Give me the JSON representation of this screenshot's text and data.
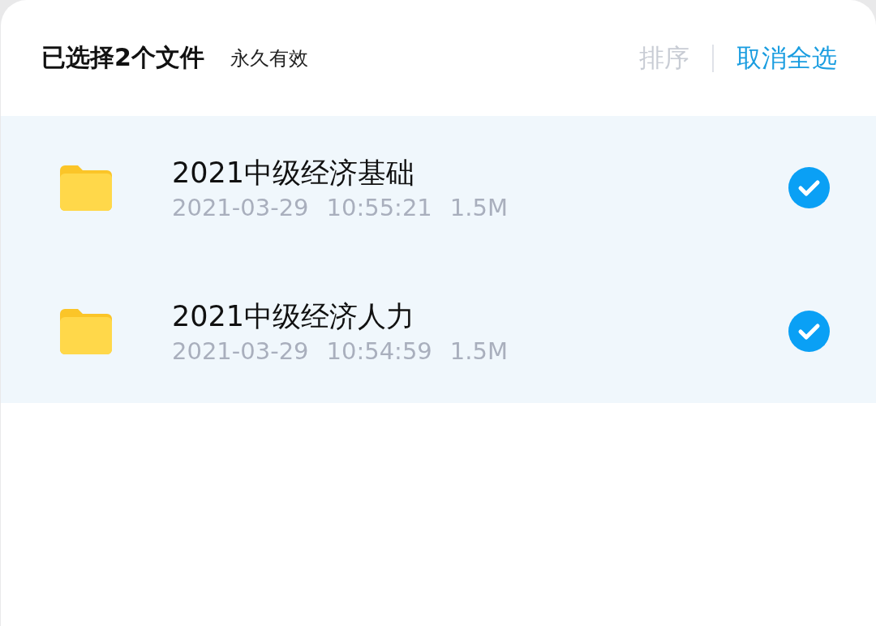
{
  "header": {
    "title": "已选择2个文件",
    "validity": "永久有效",
    "sort": {
      "label": "排序",
      "disabled": true
    },
    "deselect_all": "取消全选"
  },
  "files": [
    {
      "name": "2021中级经济基础",
      "date": "2021-03-29",
      "time": "10:55:21",
      "size": "1.5M",
      "selected": true
    },
    {
      "name": "2021中级经济人力",
      "date": "2021-03-29",
      "time": "10:54:59",
      "size": "1.5M",
      "selected": true
    }
  ]
}
